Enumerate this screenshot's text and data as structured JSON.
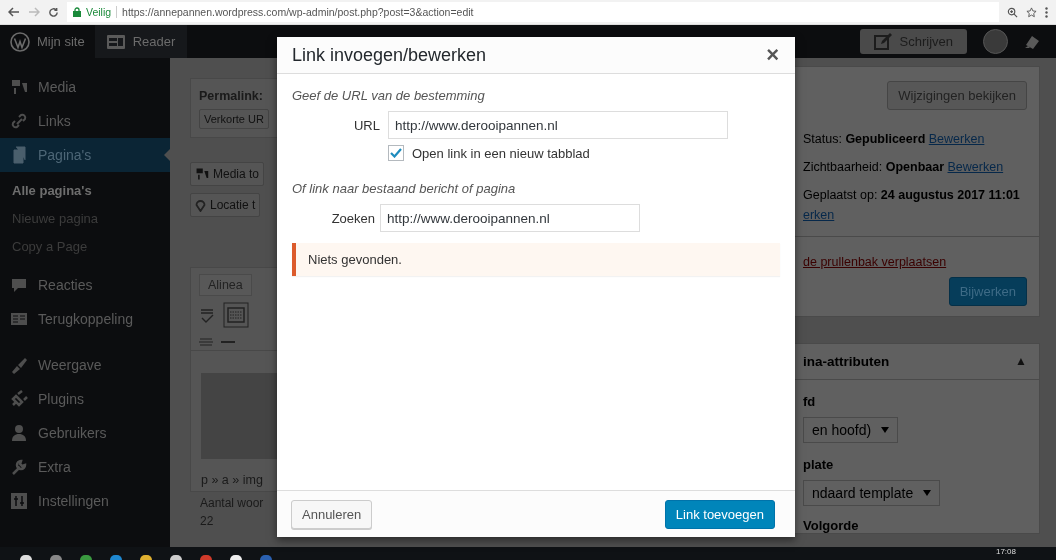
{
  "browser": {
    "secure_label": "Veilig",
    "url": "https://annepannen.wordpress.com/wp-admin/post.php?post=3&action=edit"
  },
  "admin_bar": {
    "site": "Mijn site",
    "reader": "Reader",
    "write_button": "Schrijven"
  },
  "sidebar": {
    "items": [
      {
        "label": "Media",
        "selected": false
      },
      {
        "label": "Links",
        "selected": false
      },
      {
        "label": "Pagina's",
        "selected": true,
        "children": [
          {
            "label": "Alle pagina's",
            "selected": true
          },
          {
            "label": "Nieuwe pagina",
            "selected": false
          },
          {
            "label": "Copy a Page",
            "selected": false
          }
        ]
      },
      {
        "label": "Reacties",
        "selected": false
      },
      {
        "label": "Terugkoppeling",
        "selected": false
      },
      {
        "label": "Weergave",
        "selected": false
      },
      {
        "label": "Plugins",
        "selected": false
      },
      {
        "label": "Gebruikers",
        "selected": false
      },
      {
        "label": "Extra",
        "selected": false
      },
      {
        "label": "Instellingen",
        "selected": false
      }
    ]
  },
  "editor": {
    "permalink_label": "Permalink:",
    "short_url_button": "Verkorte UR",
    "media_button": "Media to",
    "location_button": "Locatie t",
    "format_select": "Alinea",
    "path": "p » a » img",
    "word_count_label": "Aantal woor",
    "word_count": "22"
  },
  "publish_box": {
    "preview_button": "Wijzigingen bekijken",
    "status": "Status: **Gepubliceerd**",
    "status_link": "Bewerken",
    "visibility": "Zichtbaarheid: **Openbaar**",
    "visibility_link": "Bewerken",
    "published": "Geplaatst op: **24 augustus 2017 11:01**",
    "published_link": "erken",
    "trash_link": "de prullenbak verplaatsen",
    "update_button": "Bijwerken"
  },
  "attributes_box": {
    "title": "ina-attributen",
    "toggle": "▲",
    "parent_label": "fd",
    "parent_select": "en hoofd)",
    "template_label": "plate",
    "template_select": "ndaard template",
    "order_label": "Volgorde"
  },
  "dialog": {
    "title": "Link invoegen/bewerken",
    "close": "×",
    "url_heading": "Geef de URL van de bestemming",
    "url_label": "URL",
    "url_value": "http://www.derooipannen.nl",
    "new_tab": {
      "label": "Open link in een nieuw tabblad",
      "checked": true
    },
    "search_heading": "Of link naar bestaand bericht of pagina",
    "search_label": "Zoeken",
    "search_value": "http://www.derooipannen.nl",
    "notice": "Niets gevonden.",
    "cancel_button": "Annuleren",
    "submit_button": "Link toevoegen"
  },
  "taskbar": {
    "time": "17:08"
  }
}
